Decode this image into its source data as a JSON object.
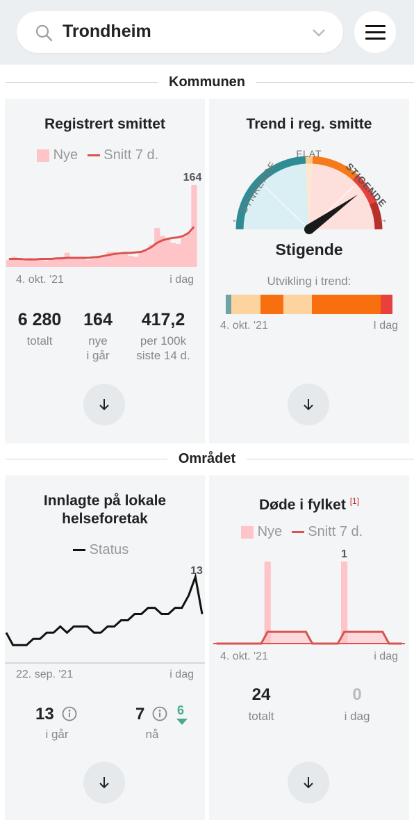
{
  "search": {
    "value": "Trondheim"
  },
  "sections": {
    "kommune": "Kommunen",
    "omrade": "Området"
  },
  "registrert": {
    "title": "Registrert smittet",
    "legend_new": "Nye",
    "legend_avg": "Snitt 7 d.",
    "max_label": "164",
    "date_start": "4. okt. '21",
    "date_end": "i dag",
    "stats": [
      {
        "value": "6 280",
        "label1": "totalt",
        "label2": ""
      },
      {
        "value": "164",
        "label1": "nye",
        "label2": "i går"
      },
      {
        "value": "417,2",
        "label1": "per 100k",
        "label2": "siste 14 d."
      }
    ],
    "chart_data": {
      "type": "bar",
      "series": [
        {
          "name": "Nye",
          "values": [
            14,
            20,
            16,
            12,
            18,
            14,
            14,
            12,
            16,
            16,
            20,
            28,
            18,
            16,
            16,
            14,
            16,
            18,
            22,
            30,
            30,
            24,
            28,
            22,
            20,
            30,
            32,
            44,
            78,
            62,
            56,
            48,
            46,
            60,
            68,
            164
          ]
        },
        {
          "name": "Snitt 7 d.",
          "values": [
            16,
            16,
            16,
            15,
            15,
            15,
            16,
            16,
            16,
            17,
            17,
            18,
            18,
            18,
            18,
            18,
            19,
            20,
            22,
            24,
            26,
            27,
            28,
            28,
            29,
            30,
            34,
            40,
            48,
            53,
            56,
            58,
            59,
            62,
            68,
            80
          ]
        }
      ],
      "ylim": [
        0,
        164
      ]
    }
  },
  "trend": {
    "title": "Trend i reg. smitte",
    "gauge_left": "SYNKENDE",
    "gauge_mid": "FLAT",
    "gauge_right": "STIGENDE",
    "status": "Stigende",
    "dev_label": "Utvikling i trend:",
    "date_start": "4. okt. '21",
    "date_end": "I dag",
    "strip": [
      {
        "color": "#6fa3a8",
        "w": 1
      },
      {
        "color": "#fdd4a0",
        "w": 5
      },
      {
        "color": "#f86f10",
        "w": 4
      },
      {
        "color": "#fdd4a0",
        "w": 5
      },
      {
        "color": "#f86f10",
        "w": 12
      },
      {
        "color": "#e8403a",
        "w": 2
      }
    ]
  },
  "innlagte": {
    "title_line1": "Innlagte på lokale",
    "title_line2": "helseforetak",
    "legend": "Status",
    "max_label": "13",
    "date_start": "22. sep. '21",
    "date_end": "i dag",
    "stat1_value": "13",
    "stat1_label": "i går",
    "stat2_value": "7",
    "stat2_label": "nå",
    "stat2_delta": "6",
    "chart_data": {
      "type": "line",
      "series": [
        {
          "name": "Status",
          "values": [
            4,
            2,
            2,
            2,
            3,
            3,
            4,
            4,
            5,
            4,
            5,
            5,
            5,
            4,
            4,
            5,
            5,
            6,
            6,
            7,
            7,
            8,
            8,
            7,
            7,
            8,
            8,
            10,
            13,
            7
          ]
        }
      ],
      "ylim": [
        0,
        13
      ]
    }
  },
  "dode": {
    "title": "Døde i fylket",
    "footnote": "[1]",
    "legend_new": "Nye",
    "legend_avg": "Snitt 7 d.",
    "max_label": "1",
    "date_start": "4. okt. '21",
    "date_end": "i dag",
    "stat1_value": "24",
    "stat1_label": "totalt",
    "stat2_value": "0",
    "stat2_label": "i dag",
    "chart_data": {
      "type": "bar",
      "series": [
        {
          "name": "Nye",
          "values": [
            0,
            0,
            0,
            0,
            0,
            0,
            0,
            0,
            1,
            0,
            0,
            0,
            0,
            0,
            0,
            0,
            0,
            0,
            0,
            0,
            1,
            0,
            0,
            0,
            0,
            0,
            0,
            0,
            0,
            0
          ]
        },
        {
          "name": "Snitt 7 d.",
          "values": [
            0,
            0,
            0,
            0,
            0,
            0,
            0,
            0,
            0.143,
            0.143,
            0.143,
            0.143,
            0.143,
            0.143,
            0.143,
            0,
            0,
            0,
            0,
            0,
            0.143,
            0.143,
            0.143,
            0.143,
            0.143,
            0.143,
            0.143,
            0,
            0,
            0
          ]
        }
      ],
      "ylim": [
        0,
        1
      ]
    }
  },
  "colors": {
    "bar": "#ffc4c8",
    "avg": "#d9534f",
    "accent_green": "#4aaa8c"
  }
}
